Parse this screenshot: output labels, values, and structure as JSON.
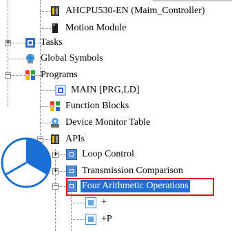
{
  "tree": {
    "items": [
      {
        "label": "AHCPU530-EN  (Maim_Controller)",
        "icon": "cpu-icon"
      },
      {
        "label": "Motion Module",
        "icon": "module-icon"
      },
      {
        "label": "Tasks",
        "icon": "tasks-icon",
        "expander": "+"
      },
      {
        "label": "Global Symbols",
        "icon": "globe-icon"
      },
      {
        "label": "Programs",
        "icon": "programs-icon",
        "expander": "−"
      },
      {
        "label": "MAIN [PRG,LD]",
        "icon": "program-icon"
      },
      {
        "label": "Function Blocks",
        "icon": "function-blocks-icon"
      },
      {
        "label": "Device Monitor Table",
        "icon": "monitor-icon"
      },
      {
        "label": "APIs",
        "icon": "apis-icon",
        "expander": "−"
      },
      {
        "label": "Loop Control",
        "icon": "api-group-icon",
        "expander": "+"
      },
      {
        "label": "Transmission Comparison",
        "icon": "api-group-icon",
        "expander": "+"
      },
      {
        "label": "Four Arithmetic Operations",
        "icon": "api-group-icon",
        "expander": "−",
        "selected": true
      },
      {
        "label": "+",
        "icon": "function-icon"
      },
      {
        "label": "+P",
        "icon": "function-icon"
      }
    ]
  },
  "colors": {
    "selection": "#1f6fd3",
    "highlight_box": "#e0161b",
    "callout_circle": "#1a6fd6"
  }
}
